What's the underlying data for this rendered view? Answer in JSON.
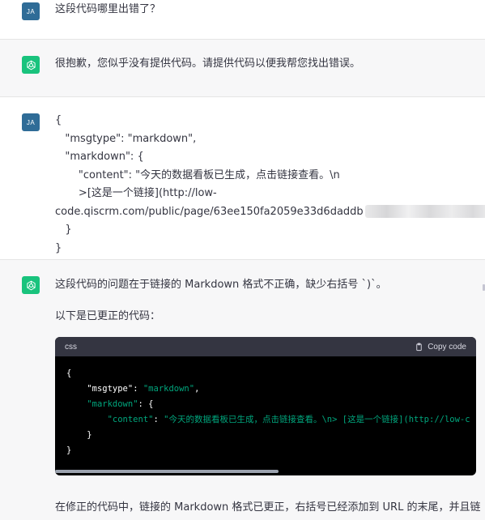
{
  "messages": [
    {
      "role": "user",
      "avatar": "JA",
      "text": "这段代码哪里出错了？"
    },
    {
      "role": "assistant",
      "text": "很抱歉，您似乎没有提供代码。请提供代码以便我帮您找出错误。"
    },
    {
      "role": "user",
      "avatar": "JA",
      "code_lines": [
        "{",
        "   \"msgtype\": \"markdown\",",
        "   \"markdown\": {",
        "       \"content\": \"今天的数据看板已生成，点击链接查看。\\n",
        "       >[这是一个链接](http://low-",
        "code.qiscrm.com/public/page/63ee150fa2059e33d6daddb",
        "   }",
        "}"
      ]
    },
    {
      "role": "assistant",
      "text1": "这段代码的问题在于链接的 Markdown 格式不正确，缺少右括号 `)`。",
      "text2": "以下是已更正的代码：",
      "code": {
        "lang": "css",
        "copy_label": "Copy code",
        "tokens": {
          "brace_open": "{",
          "k1": "\"msgtype\"",
          "v1": "\"markdown\"",
          "k2": "\"markdown\"",
          "k3": "\"content\"",
          "v3": "\"今天的数据看板已生成，点击链接查看。\\n> [这是一个链接](http://low-c",
          "brace_inner_close": "}",
          "brace_close": "}"
        }
      },
      "text3": "在修正的代码中，链接的 Markdown 格式已更正，右括号已经添加到 URL 的末尾，并且链"
    }
  ],
  "colors": {
    "user_avatar": "#2f6c97",
    "gpt_avatar": "#19c37d",
    "code_string": "#00a67d"
  }
}
